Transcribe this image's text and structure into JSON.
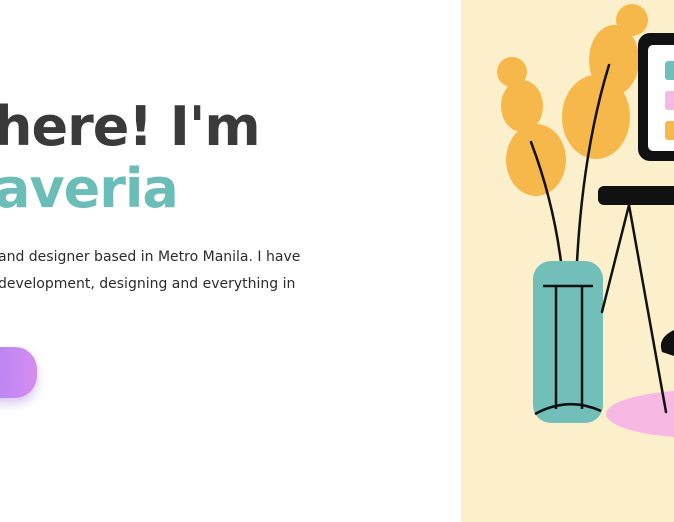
{
  "hero": {
    "greeting_line": "here! I'm",
    "name_line": "averia",
    "intro_line1": "and designer based in Metro Manila. I have",
    "intro_line2": "development, designing and everything in"
  },
  "colors": {
    "heading": "#3a3a3a",
    "accent_teal": "#6bbdb7",
    "illustration_bg": "#fcefcb",
    "leaf_orange": "#f6b84a",
    "vase_teal": "#72bfb9",
    "rug_pink": "#f6b9e4",
    "button_gradient_start": "#a37ff7",
    "button_gradient_end": "#d58df0"
  },
  "illustration": {
    "icons": [
      "plant-in-vase-icon",
      "monitor-icon",
      "desk-icon",
      "rug-icon"
    ]
  }
}
